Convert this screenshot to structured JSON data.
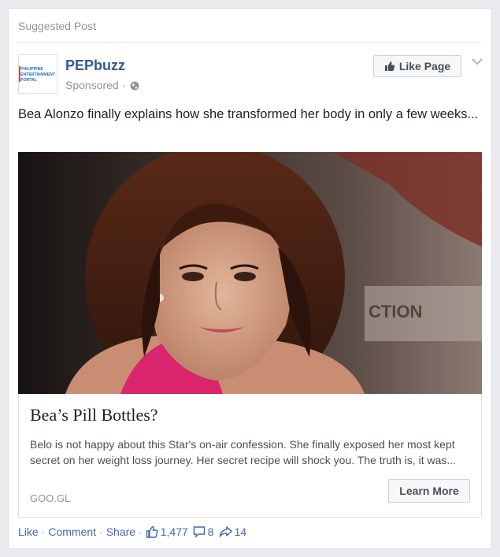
{
  "header": {
    "suggested_label": "Suggested Post"
  },
  "page": {
    "name": "PEPbuzz",
    "sponsored_label": "Sponsored",
    "sponsored_sep": " · ",
    "logo_text": [
      "PHILIPPINE",
      "ENTERTAINMENT",
      "PORTAL"
    ]
  },
  "like_page_button": {
    "label": "Like Page"
  },
  "post": {
    "text": "Bea Alonzo finally explains how she transformed her body in only a few weeks..."
  },
  "link": {
    "title": "Bea’s Pill Bottles?",
    "description": "Belo is not happy about this Star's on-air confession. She finally exposed her most kept secret on her weight loss journey. Her secret recipe will shock you. The truth is, it was...",
    "domain": "GOO.GL",
    "cta_label": "Learn More"
  },
  "photo": {
    "background_text": "CTION"
  },
  "actions": {
    "like": "Like",
    "comment": "Comment",
    "share": "Share",
    "likes_count": "1,477",
    "comments_count": "8",
    "shares_count": "14"
  },
  "colors": {
    "link_blue": "#365899",
    "action_blue": "#4267b2",
    "grey_text": "#90949c"
  }
}
